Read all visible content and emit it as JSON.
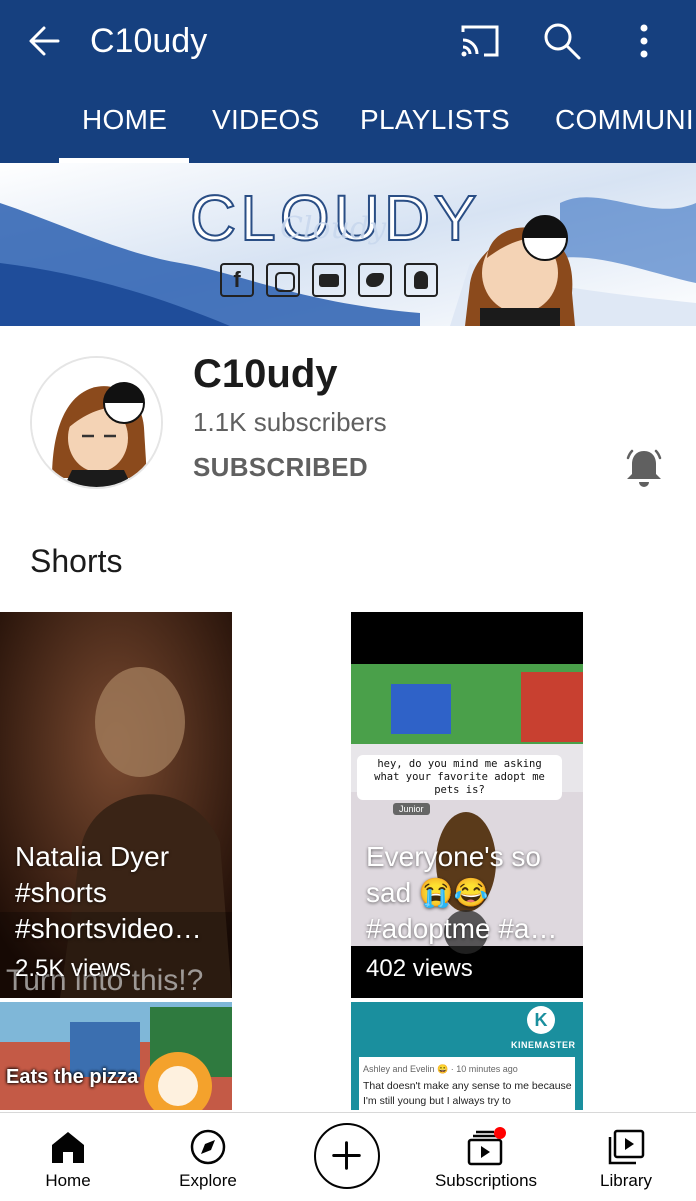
{
  "header": {
    "title": "C10udy",
    "back_icon": "arrow-left-icon",
    "cast_icon": "cast-icon",
    "search_icon": "search-icon",
    "more_icon": "more-vert-icon",
    "background": "#16407f"
  },
  "tabs": [
    {
      "label": "HOME",
      "selected": true
    },
    {
      "label": "VIDEOS",
      "selected": false
    },
    {
      "label": "PLAYLISTS",
      "selected": false
    },
    {
      "label": "COMMUNI",
      "selected": false
    }
  ],
  "banner": {
    "headline": "CLOUDY",
    "script_text": "Cloudy",
    "social_icons": [
      "facebook-icon",
      "instagram-icon",
      "youtube-icon",
      "twitter-icon",
      "snapchat-icon"
    ]
  },
  "channel": {
    "name": "C10udy",
    "subscribers": "1.1K subscribers",
    "subscribed_label": "SUBSCRIBED",
    "bell_icon": "bell-icon"
  },
  "shorts": {
    "section_title": "Shorts",
    "items": [
      {
        "title": "Natalia Dyer #shorts #shortsvideo…",
        "views": "2.5K views",
        "overlay_text": "Turn into this!?"
      },
      {
        "title": "Everyone's so sad 😭😂 #adoptme #a…",
        "views": "402 views",
        "chat_text": "hey, do you mind me asking what your favorite adopt me pets is?",
        "name_tag": "Junior"
      },
      {
        "title": "",
        "views": "",
        "overlay_text": "Eats the pizza"
      },
      {
        "title": "",
        "views": "",
        "brand": "KINEMASTER",
        "chat_header": "Ashley and Evelin 😀 · 10 minutes ago",
        "chat_text": "That doesn't make any sense to me because I'm still young but I always try to"
      }
    ]
  },
  "bottom_nav": [
    {
      "label": "Home",
      "icon": "home-icon"
    },
    {
      "label": "Explore",
      "icon": "compass-icon"
    },
    {
      "label": "",
      "icon": "create-plus-icon"
    },
    {
      "label": "Subscriptions",
      "icon": "subscriptions-icon"
    },
    {
      "label": "Library",
      "icon": "library-icon"
    }
  ]
}
